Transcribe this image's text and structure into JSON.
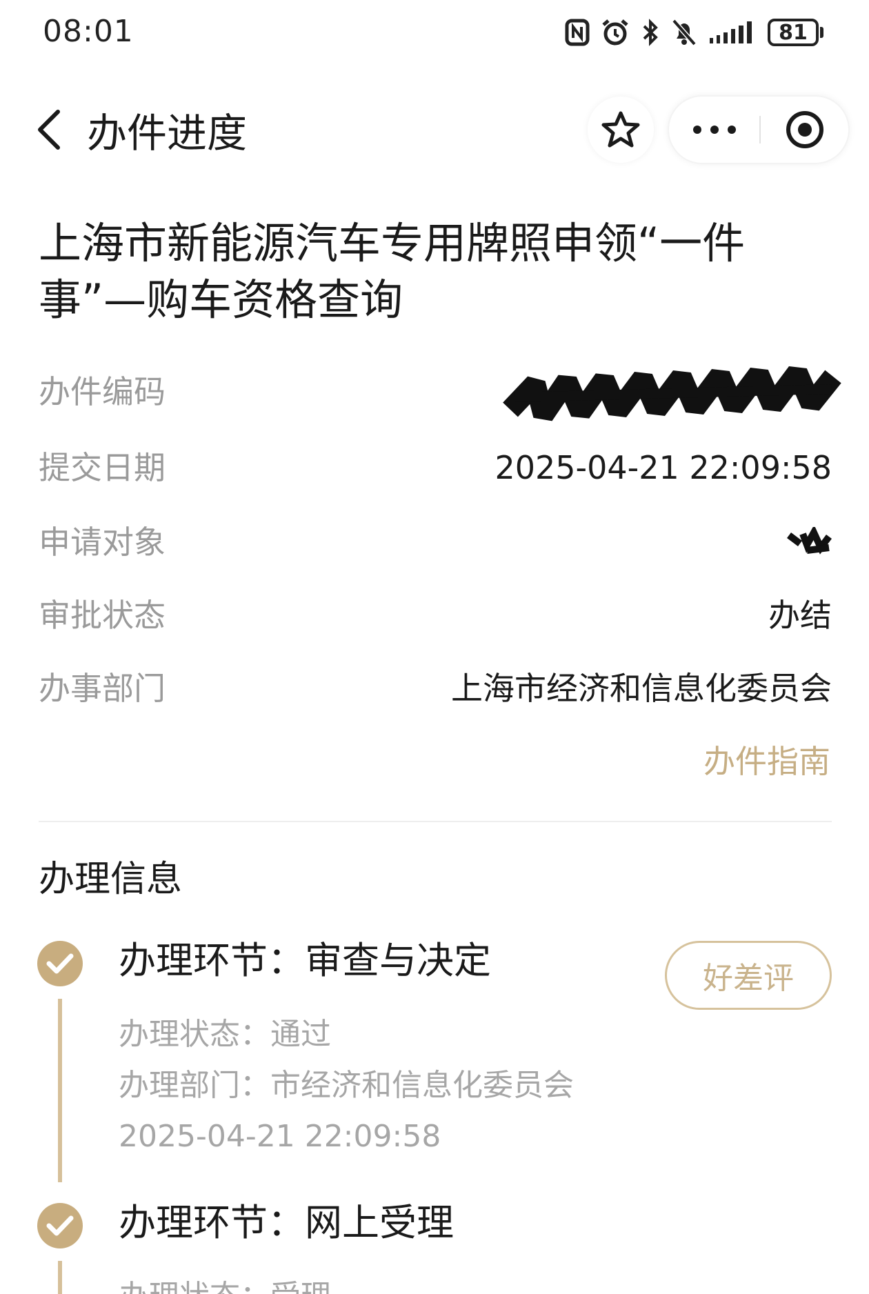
{
  "status_bar": {
    "time": "08:01",
    "battery": "81",
    "icons": [
      "nfc-icon",
      "alarm-icon",
      "bluetooth-icon",
      "bell-off-icon",
      "signal-icon",
      "battery-icon"
    ]
  },
  "nav": {
    "title": "办件进度",
    "icons": [
      "back-arrow-icon",
      "star-icon",
      "more-icon",
      "close-target-icon"
    ]
  },
  "service": {
    "title": "上海市新能源汽车专用牌照申领“一件事”—购车资格查询"
  },
  "info": {
    "code_label": "办件编码",
    "date_label": "提交日期",
    "date_value": "2025-04-21 22:09:58",
    "applicant_label": "申请对象",
    "status_label": "审批状态",
    "status_value": "办结",
    "department_label": "办事部门",
    "department_value": "上海市经济和信息化委员会",
    "guide_link": "办件指南"
  },
  "process": {
    "section_title": "办理信息",
    "steps": [
      {
        "title": "办理环节：审查与决定",
        "status": "办理状态：通过",
        "department": "办理部门：市经济和信息化委员会",
        "time": "2025-04-21 22:09:58",
        "rate_label": "好差评"
      },
      {
        "title": "办理环节：网上受理",
        "status": "办理状态：受理"
      }
    ]
  },
  "colors": {
    "accent": "#c8ad7f",
    "label": "#9a9a9a",
    "text": "#1a1a1a"
  }
}
